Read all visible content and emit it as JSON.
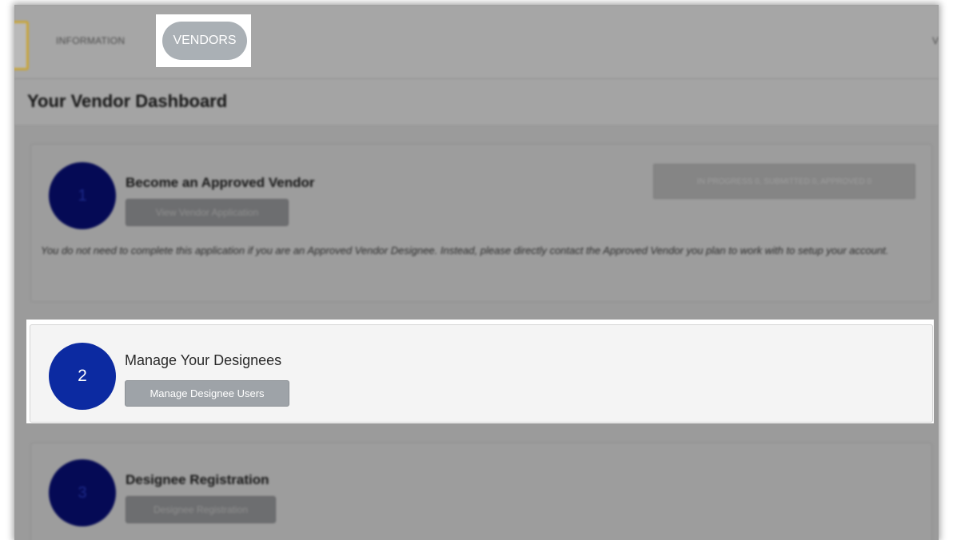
{
  "nav": {
    "information_label": "INFORMATION",
    "vendors_label": "VENDORS",
    "right_label": "V"
  },
  "header": {
    "title": "Your Vendor Dashboard"
  },
  "cards": [
    {
      "number": "1",
      "title": "Become an Approved Vendor",
      "button_label": "View Vendor Application",
      "status_label": "IN PROGRESS 0, SUBMITTED 0, APPROVED 0",
      "note": "You do not need to complete this application if you are an Approved Vendor Designee. Instead, please directly contact the Approved Vendor you plan to work with to setup your account."
    },
    {
      "number": "2",
      "title": "Manage Your Designees",
      "button_label": "Manage Designee Users"
    },
    {
      "number": "3",
      "title": "Designee Registration",
      "button_label": "Designee Registration"
    }
  ],
  "colors": {
    "overlay": "#9b9b9b",
    "active_circle": "#0c2aa1",
    "dim_circle": "#050a55",
    "active_button": "#9ea3a8"
  }
}
